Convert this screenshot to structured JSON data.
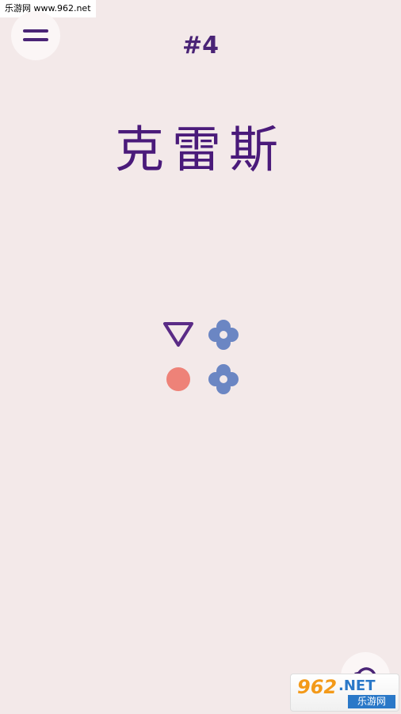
{
  "watermark": {
    "text": "乐游网 www.962.net"
  },
  "header": {
    "menu_icon": "hamburger-menu-icon",
    "level_label": "#4",
    "title": "克雷斯"
  },
  "board": {
    "pieces": [
      {
        "shape": "triangle",
        "color": "#5a2b86"
      },
      {
        "shape": "flower",
        "color": "#6b86c3"
      },
      {
        "shape": "circle",
        "color": "#ee8278"
      },
      {
        "shape": "flower",
        "color": "#6b86c3"
      }
    ]
  },
  "footer": {
    "restart_icon": "restart-icon",
    "brand": {
      "num": "962",
      "net": ".NET",
      "cn": "乐游网"
    }
  },
  "colors": {
    "background": "#f3e9e9",
    "accent": "#4a2476",
    "button_bg": "#fbf6f6"
  }
}
